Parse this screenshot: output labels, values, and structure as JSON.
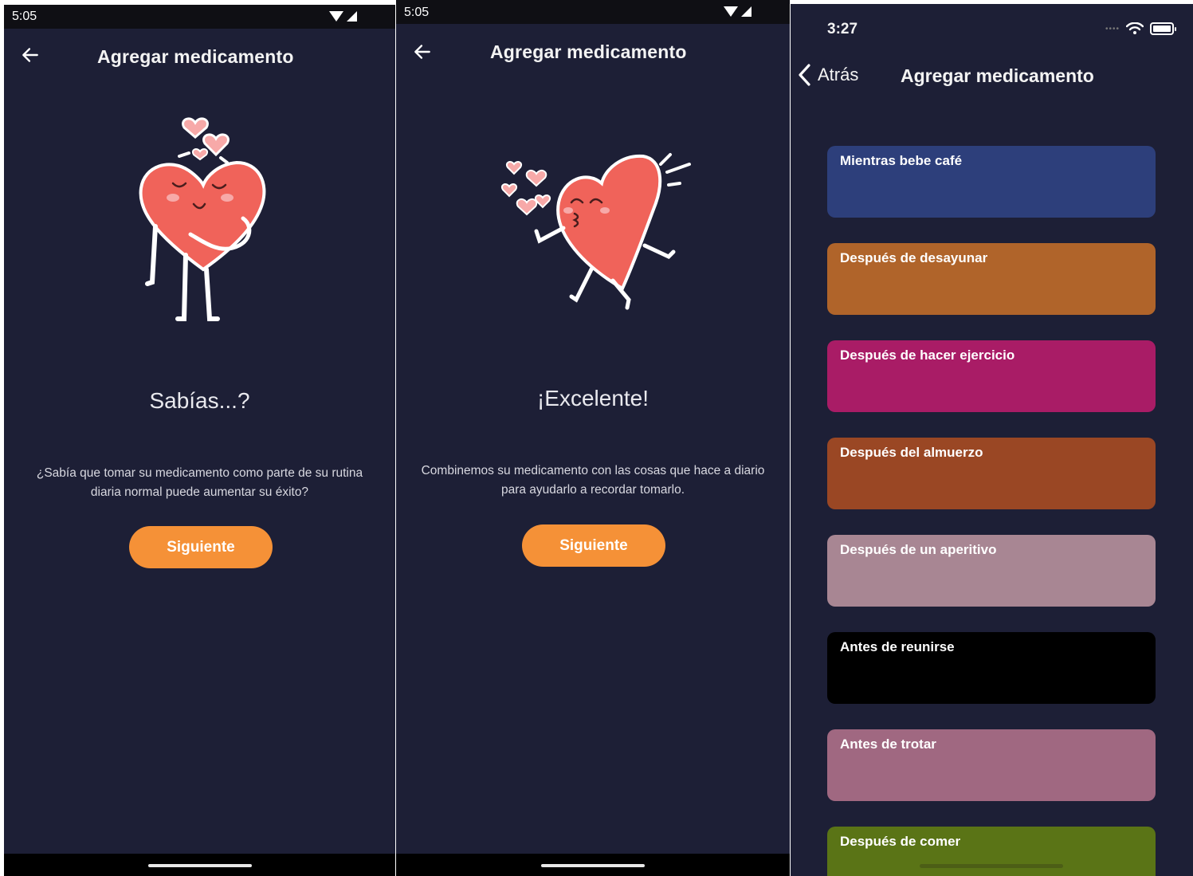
{
  "screen1": {
    "status_time": "5:05",
    "title": "Agregar medicamento",
    "heading": "Sabías...?",
    "body": "¿Sabía que tomar su medicamento como parte de su rutina diaria normal puede aumentar su éxito?",
    "button": "Siguiente"
  },
  "screen2": {
    "status_time": "5:05",
    "title": "Agregar medicamento",
    "heading": "¡Excelente!",
    "body": "Combinemos su medicamento con las cosas que hace a diario para ayudarlo a recordar tomarlo.",
    "button": "Siguiente"
  },
  "screen3": {
    "status_time": "3:27",
    "back_label": "Atrás",
    "title": "Agregar medicamento",
    "routines": [
      {
        "label": "Mientras bebe café",
        "color": "#2d3f7b"
      },
      {
        "label": "Después de desayunar",
        "color": "#b0642a"
      },
      {
        "label": "Después de hacer ejercicio",
        "color": "#a91c66"
      },
      {
        "label": "Después del almuerzo",
        "color": "#9a4724"
      },
      {
        "label": "Después de un aperitivo",
        "color": "#a88693"
      },
      {
        "label": "Antes de reunirse",
        "color": "#000000"
      },
      {
        "label": "Antes de trotar",
        "color": "#a06881"
      },
      {
        "label": "Después de comer",
        "color": "#5a7416"
      }
    ]
  },
  "theme": {
    "background": "#1d1f36",
    "accent": "#f59137",
    "heart": "#f0635a"
  }
}
